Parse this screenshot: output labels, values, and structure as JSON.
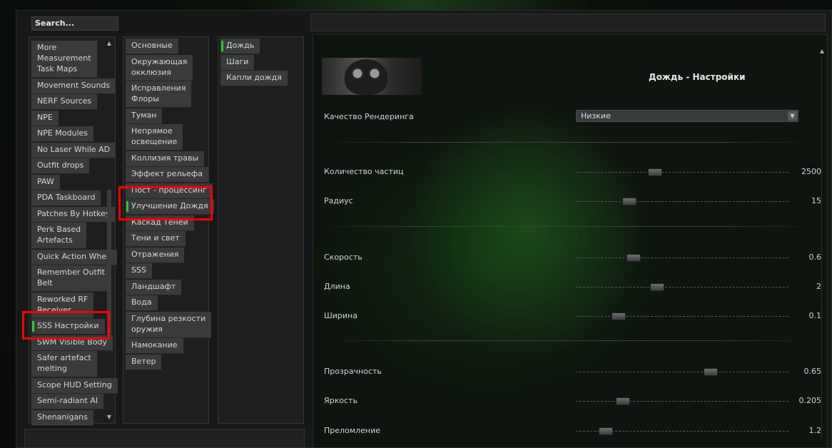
{
  "search": {
    "label": "Search..."
  },
  "mods_list": {
    "items": [
      {
        "label": "More\nMeasurement\nTask Maps",
        "top": 0
      },
      {
        "label": "Movement Sounds"
      },
      {
        "label": "NERF Sources"
      },
      {
        "label": "NPE"
      },
      {
        "label": "NPE Modules"
      },
      {
        "label": "No Laser While AD"
      },
      {
        "label": "Outfit drops"
      },
      {
        "label": "PAW"
      },
      {
        "label": "PDA Taskboard"
      },
      {
        "label": "Patches By Hotkey"
      },
      {
        "label": "Perk Based\nArtefacts"
      },
      {
        "label": "Quick Action Whee"
      },
      {
        "label": "Remember Outfit\nBelt"
      },
      {
        "label": "Reworked RF\nReceiver"
      },
      {
        "label": "SSS Настройки"
      },
      {
        "label": "SWM Visible Body"
      },
      {
        "label": "Safer artefact\nmelting"
      },
      {
        "label": "Scope HUD Setting"
      },
      {
        "label": "Semi-radiant AI"
      },
      {
        "label": "Shenanigans"
      }
    ],
    "selected": "SSS Настройки"
  },
  "categories": {
    "items": [
      {
        "label": "Основные"
      },
      {
        "label": "Окружающая\nокклюзия"
      },
      {
        "label": "Исправления\nФлоры"
      },
      {
        "label": "Туман"
      },
      {
        "label": "Непрямое\nосвещение"
      },
      {
        "label": "Коллизия травы"
      },
      {
        "label": "Эффект рельефа"
      },
      {
        "label": "Пост - процессинг"
      },
      {
        "label": "Улучшение Дождя"
      },
      {
        "label": "Каскад Теней"
      },
      {
        "label": "Тени и свет"
      },
      {
        "label": "Отражения"
      },
      {
        "label": "SSS"
      },
      {
        "label": "Ландшафт"
      },
      {
        "label": "Вода"
      },
      {
        "label": "Глубина резкости\nоружия"
      },
      {
        "label": "Намокание"
      },
      {
        "label": "Ветер"
      }
    ],
    "selected": "Улучшение Дождя"
  },
  "subcategories": {
    "items": [
      {
        "label": "Дождь"
      },
      {
        "label": "Шаги"
      },
      {
        "label": "Капли дождя"
      }
    ],
    "selected": "Дождь"
  },
  "settings": {
    "title": "Дождь - Настройки",
    "render_quality": {
      "label": "Качество Рендеринга",
      "value": "Низкие"
    },
    "sliders": [
      {
        "label": "Количество частиц",
        "value": "2500",
        "level": 0.37
      },
      {
        "label": "Радиус",
        "value": "15",
        "level": 0.25
      },
      {
        "label": "Скорость",
        "value": "0.6",
        "level": 0.27
      },
      {
        "label": "Длина",
        "value": "2",
        "level": 0.38
      },
      {
        "label": "Ширина",
        "value": "0.1",
        "level": 0.2
      },
      {
        "label": "Прозрачность",
        "value": "0.65",
        "level": 0.63
      },
      {
        "label": "Яркость",
        "value": "0.205",
        "level": 0.22
      },
      {
        "label": "Преломление",
        "value": "1.2",
        "level": 0.14
      }
    ]
  },
  "colors": {
    "accent": "#35c435",
    "highlight_box": "#ff0000"
  }
}
